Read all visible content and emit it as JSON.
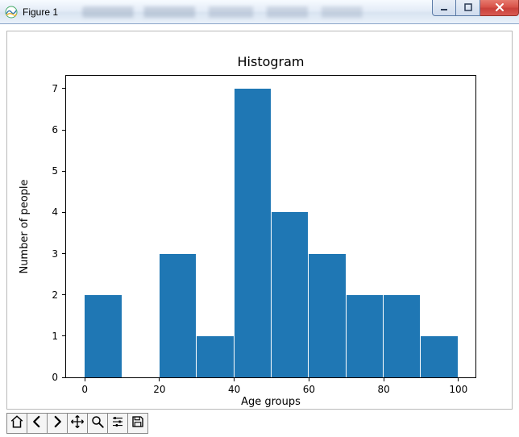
{
  "window": {
    "title": "Figure 1"
  },
  "toolbar": {
    "home": "home-icon",
    "back": "arrow-left-icon",
    "forward": "arrow-right-icon",
    "pan": "move-icon",
    "zoom": "zoom-icon",
    "configure": "sliders-icon",
    "save": "save-icon"
  },
  "chart_data": {
    "type": "bar",
    "title": "Histogram",
    "xlabel": "Age groups",
    "ylabel": "Number of people",
    "xlim": [
      -5,
      105
    ],
    "ylim": [
      0,
      7.35
    ],
    "xticks": [
      0,
      20,
      40,
      60,
      80,
      100
    ],
    "yticks": [
      0,
      1,
      2,
      3,
      4,
      5,
      6,
      7
    ],
    "bin_edges": [
      0,
      10,
      20,
      30,
      40,
      50,
      60,
      70,
      80,
      90,
      100
    ],
    "values": [
      2,
      0,
      3,
      1,
      7,
      4,
      3,
      2,
      2,
      1
    ],
    "bar_color": "#1f77b4"
  }
}
